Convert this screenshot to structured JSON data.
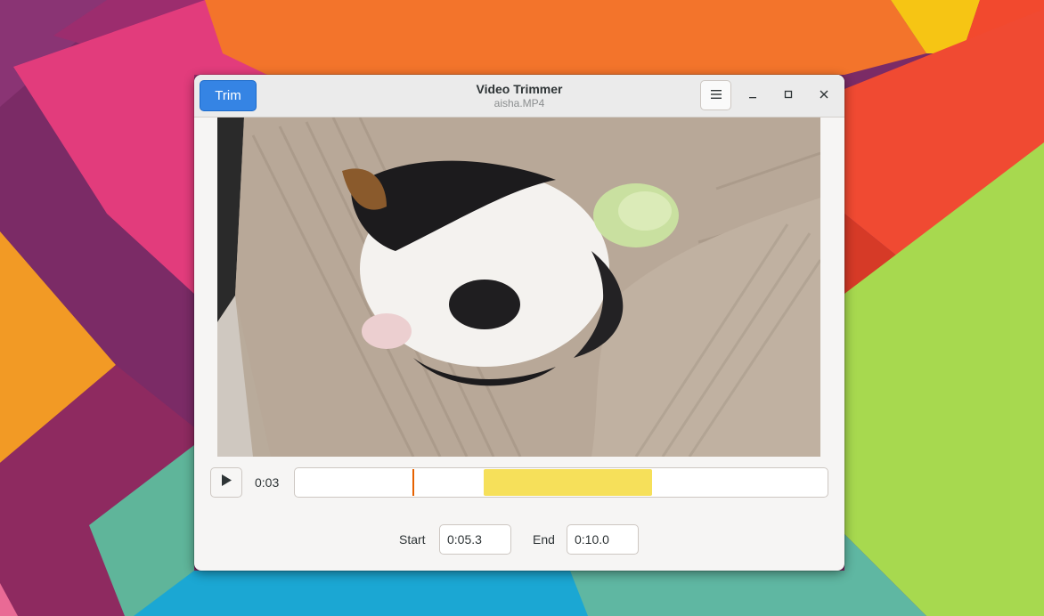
{
  "header": {
    "trim_label": "Trim",
    "title": "Video Trimmer",
    "subtitle": "aisha.MP4",
    "menu_icon": "hamburger-menu-icon",
    "window_controls": [
      "minimize-icon",
      "maximize-icon",
      "close-icon"
    ]
  },
  "playback": {
    "play_icon": "play-icon",
    "current_time": "0:03",
    "playhead_fraction": 0.22,
    "selection_start_fraction": 0.355,
    "selection_end_fraction": 0.67
  },
  "trim_fields": {
    "start_label": "Start",
    "start_value": "0:05.3",
    "end_label": "End",
    "end_value": "0:10.0"
  },
  "colors": {
    "accent": "#3584e4",
    "selection": "#f6e05a",
    "playhead": "#e66100"
  }
}
